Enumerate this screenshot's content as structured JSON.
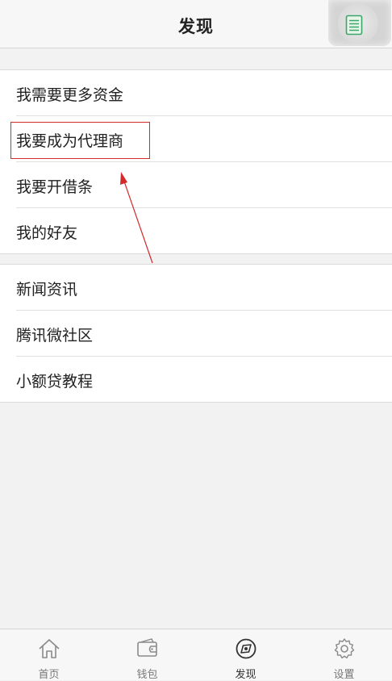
{
  "header": {
    "title": "发现"
  },
  "float_button": {
    "icon": "document-list-icon"
  },
  "group1": {
    "items": [
      {
        "label": "我需要更多资金"
      },
      {
        "label": "我要成为代理商"
      },
      {
        "label": "我要开借条"
      },
      {
        "label": "我的好友"
      }
    ]
  },
  "group2": {
    "items": [
      {
        "label": "新闻资讯"
      },
      {
        "label": "腾讯微社区"
      },
      {
        "label": "小额贷教程"
      }
    ]
  },
  "annotation": {
    "highlight_color": "#d22b2b",
    "highlighted_item": "我要成为代理商"
  },
  "tabbar": {
    "tabs": [
      {
        "label": "首页",
        "icon": "home-icon"
      },
      {
        "label": "钱包",
        "icon": "wallet-icon"
      },
      {
        "label": "发现",
        "icon": "compass-icon",
        "active": true
      },
      {
        "label": "设置",
        "icon": "gear-icon"
      }
    ]
  },
  "colors": {
    "background": "#f2f2f2",
    "accent_green": "#3aa66a"
  }
}
